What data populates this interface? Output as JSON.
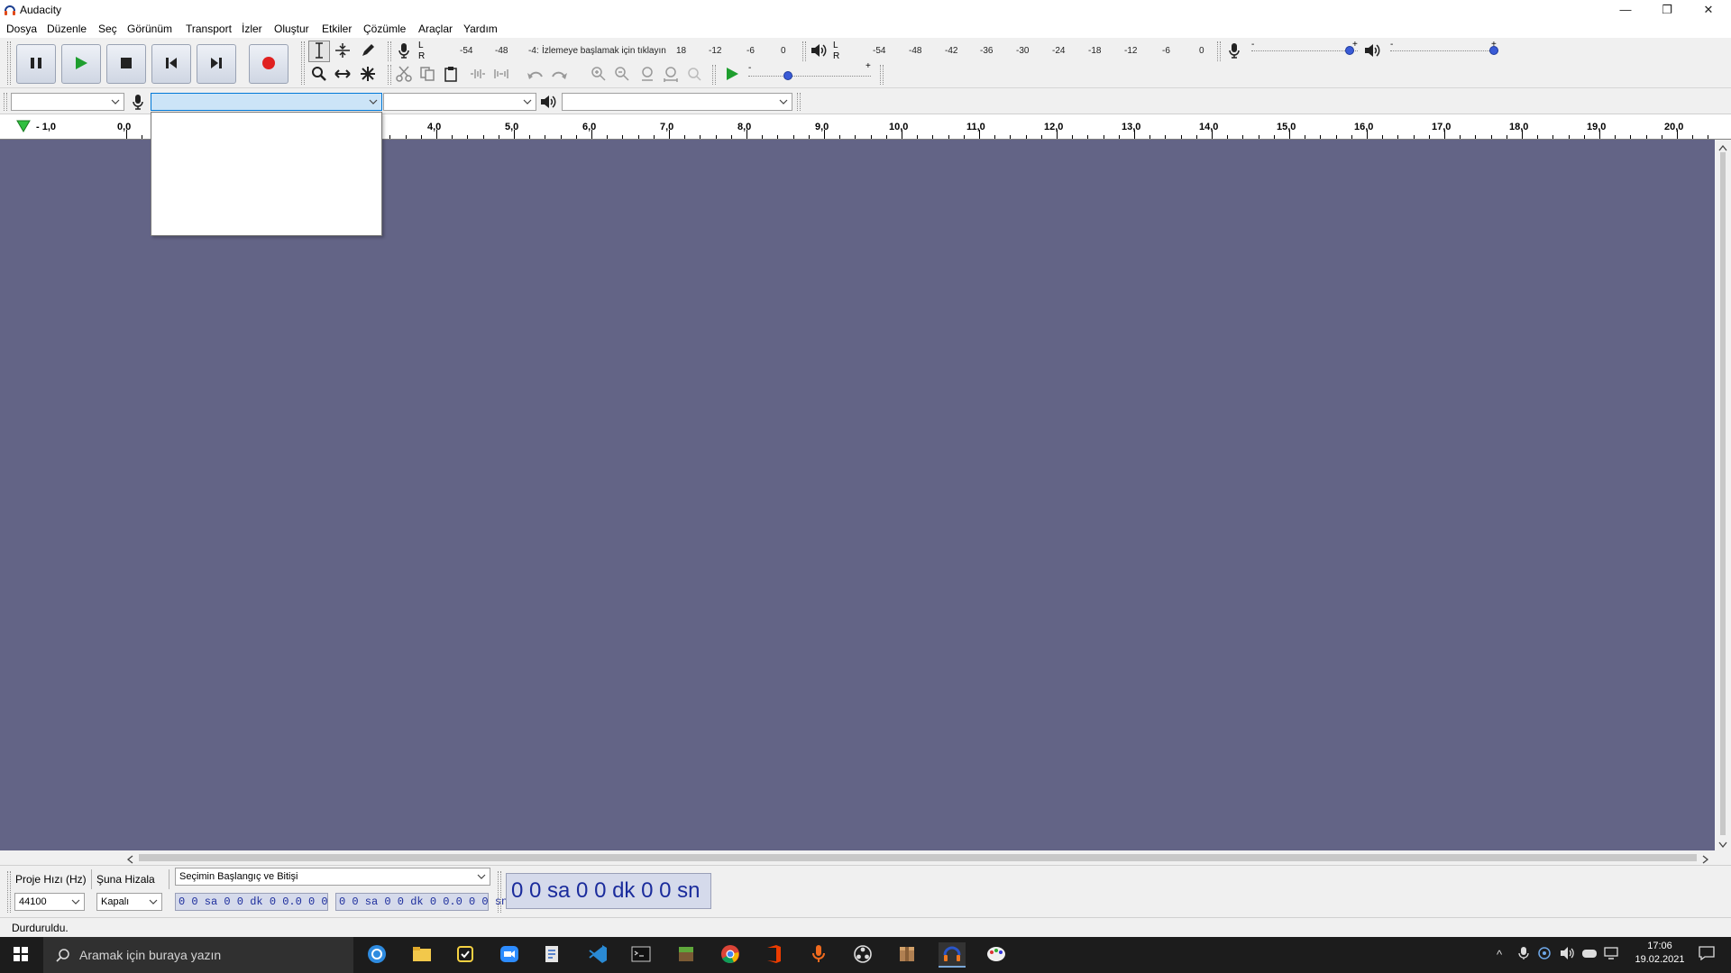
{
  "window": {
    "title": "Audacity",
    "controls": {
      "minimize": "—",
      "maximize": "❐",
      "close": "✕"
    }
  },
  "menu": {
    "items": [
      "Dosya",
      "Düzenle",
      "Seç",
      "Görünüm",
      "Transport",
      "İzler",
      "Oluştur",
      "Etkiler",
      "Çözümle",
      "Araçlar",
      "Yardım"
    ]
  },
  "transport": {
    "buttons": [
      {
        "name": "pause-button",
        "icon": "pause-icon"
      },
      {
        "name": "play-button",
        "icon": "play-icon"
      },
      {
        "name": "stop-button",
        "icon": "stop-icon"
      },
      {
        "name": "skip-start-button",
        "icon": "skip-start-icon"
      },
      {
        "name": "skip-end-button",
        "icon": "skip-end-icon"
      },
      {
        "name": "record-button",
        "icon": "record-icon"
      }
    ]
  },
  "recording_meter": {
    "l_label": "L",
    "r_label": "R",
    "ticks": [
      "-54",
      "-48",
      "-4:"
    ],
    "prompt": "İzlemeye başlamak için tıklayın",
    "ticks_after": [
      "18",
      "-12",
      "-6",
      "0"
    ]
  },
  "playback_meter": {
    "l_label": "L",
    "r_label": "R",
    "ticks": [
      "-54",
      "-48",
      "-42",
      "-36",
      "-30",
      "-24",
      "-18",
      "-12",
      "-6",
      "0"
    ]
  },
  "mixer": {
    "minus": "-",
    "plus": "+",
    "record_volume_level": 0.92,
    "playback_volume_level": 0.96
  },
  "play_at_speed": {
    "minus": "-",
    "plus": "+",
    "speed_level": 0.32
  },
  "device": {
    "host_value": "",
    "input_value": "",
    "channels_value": "",
    "output_value": ""
  },
  "ruler": {
    "labels": [
      "- 1,0",
      "0,0",
      "4,0",
      "5,0",
      "6,0",
      "7,0",
      "8,0",
      "9,0",
      "10,0",
      "11,0",
      "12,0",
      "13,0",
      "14,0",
      "15,0",
      "16,0",
      "17,0",
      "18,0",
      "19,0",
      "20,0"
    ]
  },
  "selection": {
    "project_rate_label": "Proje Hızı (Hz)",
    "project_rate_value": "44100",
    "snap_label": "Şuna Hizala",
    "snap_value": "Kapalı",
    "mode_value": "Seçimin Başlangıç ve Bitişi",
    "start_time": "0 0 sa 0 0 dk 0 0.0 0 0 sn",
    "end_time": "0 0 sa 0 0 dk 0 0.0 0 0 sn",
    "audio_position": "0 0 sa 0 0 dk 0 0 sn"
  },
  "status": {
    "text": "Durduruldu."
  },
  "taskbar": {
    "search_placeholder": "Aramak için buraya yazın",
    "time": "17:06",
    "date": "19.02.2021"
  }
}
